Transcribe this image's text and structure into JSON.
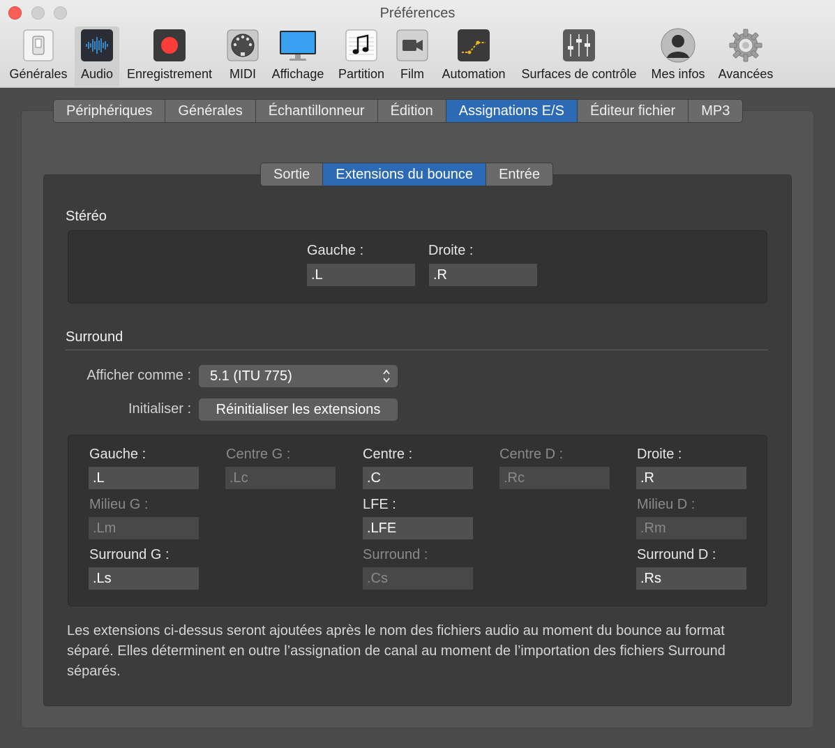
{
  "window": {
    "title": "Préférences"
  },
  "toolbar": {
    "items": [
      {
        "label": "Générales",
        "icon": "switch-icon"
      },
      {
        "label": "Audio",
        "icon": "waveform-icon",
        "selected": true
      },
      {
        "label": "Enregistrement",
        "icon": "record-icon"
      },
      {
        "label": "MIDI",
        "icon": "midi-connector-icon"
      },
      {
        "label": "Affichage",
        "icon": "monitor-icon"
      },
      {
        "label": "Partition",
        "icon": "music-note-icon"
      },
      {
        "label": "Film",
        "icon": "video-camera-icon"
      },
      {
        "label": "Automation",
        "icon": "automation-curve-icon"
      },
      {
        "label": "Surfaces de contrôle",
        "icon": "faders-icon"
      },
      {
        "label": "Mes infos",
        "icon": "user-silhouette-icon"
      },
      {
        "label": "Avancées",
        "icon": "gear-icon"
      }
    ]
  },
  "tabs": {
    "items": [
      "Périphériques",
      "Générales",
      "Échantillonneur",
      "Édition",
      "Assignations E/S",
      "Éditeur fichier",
      "MP3"
    ],
    "active": "Assignations E/S"
  },
  "subtabs": {
    "items": [
      "Sortie",
      "Extensions du bounce",
      "Entrée"
    ],
    "active": "Extensions du bounce"
  },
  "stereo": {
    "title": "Stéréo",
    "left_label": "Gauche :",
    "left_value": ".L",
    "right_label": "Droite :",
    "right_value": ".R"
  },
  "surround": {
    "title": "Surround",
    "display_as_label": "Afficher comme :",
    "display_as_value": "5.1 (ITU 775)",
    "init_label": "Initialiser :",
    "reset_button": "Réinitialiser les extensions",
    "channels": {
      "gauche": {
        "label": "Gauche :",
        "value": ".L",
        "enabled": true
      },
      "centre_g": {
        "label": "Centre G :",
        "value": ".Lc",
        "enabled": false
      },
      "centre": {
        "label": "Centre :",
        "value": ".C",
        "enabled": true
      },
      "centre_d": {
        "label": "Centre D :",
        "value": ".Rc",
        "enabled": false
      },
      "droite": {
        "label": "Droite :",
        "value": ".R",
        "enabled": true
      },
      "milieu_g": {
        "label": "Milieu G :",
        "value": ".Lm",
        "enabled": false
      },
      "lfe": {
        "label": "LFE :",
        "value": ".LFE",
        "enabled": true
      },
      "milieu_d": {
        "label": "Milieu D :",
        "value": ".Rm",
        "enabled": false
      },
      "surround_g": {
        "label": "Surround G :",
        "value": ".Ls",
        "enabled": true
      },
      "surround": {
        "label": "Surround :",
        "value": ".Cs",
        "enabled": false
      },
      "surround_d": {
        "label": "Surround D :",
        "value": ".Rs",
        "enabled": true
      }
    }
  },
  "description": "Les extensions ci-dessus seront ajoutées après le nom des fichiers audio au moment du bounce au format séparé. Elles déterminent en outre l’assignation de canal au moment de l’importation des fichiers Surround séparés.",
  "colors": {
    "accent": "#2d6ab5",
    "record": "#fc3d39",
    "close": "#fc5f57"
  }
}
